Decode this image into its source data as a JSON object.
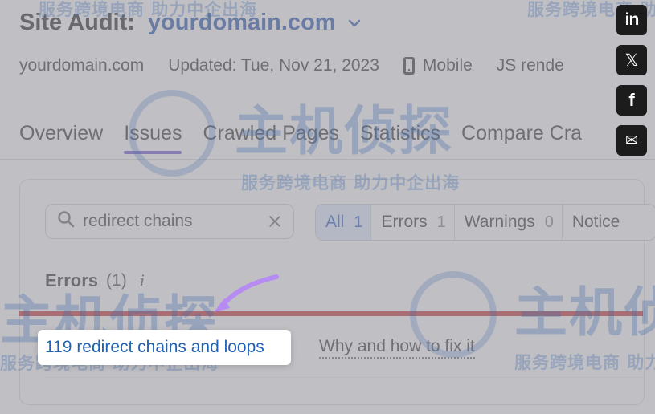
{
  "header": {
    "site_audit_label": "Site Audit:",
    "domain_title": "yourdomain.com"
  },
  "meta": {
    "domain": "yourdomain.com",
    "updated": "Updated: Tue, Nov 21, 2023",
    "device": "Mobile",
    "js_render": "JS rende"
  },
  "tabs": {
    "items": [
      {
        "label": "Overview",
        "active": false
      },
      {
        "label": "Issues",
        "active": true
      },
      {
        "label": "Crawled Pages",
        "active": false
      },
      {
        "label": "Statistics",
        "active": false
      },
      {
        "label": "Compare Cra",
        "active": false
      }
    ]
  },
  "search": {
    "value": "redirect chains"
  },
  "filters": [
    {
      "label": "All",
      "count": "1",
      "active": true
    },
    {
      "label": "Errors",
      "count": "1",
      "active": false
    },
    {
      "label": "Warnings",
      "count": "0",
      "active": false
    },
    {
      "label": "Notice",
      "count": "",
      "active": false
    }
  ],
  "errors": {
    "title": "Errors",
    "count": "(1)",
    "info_glyph": "i"
  },
  "issue": {
    "link_text": "119 redirect chains and loops",
    "fix_text": "Why and how to fix it"
  },
  "watermark": {
    "big": "主机侦探",
    "small": "服务跨境电商 助力中企出海"
  },
  "social": {
    "linkedin": "in",
    "x": "𝕏",
    "facebook": "f",
    "email": "✉"
  },
  "colors": {
    "brand_blue": "#1f4ea8",
    "active_tab": "#6b4ccc",
    "error_red": "#c3272b",
    "link_blue": "#1e62b7",
    "arrow_purple": "#b68cf2"
  }
}
